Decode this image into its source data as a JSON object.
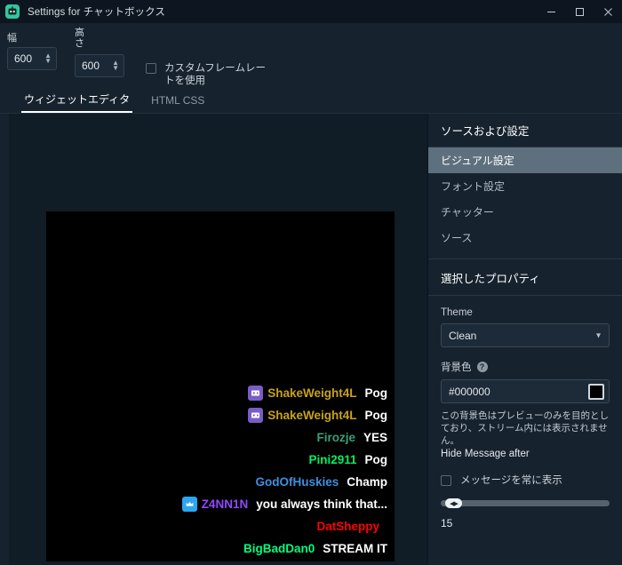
{
  "window": {
    "title": "Settings for チャットボックス",
    "app_icon": "chatbot-icon",
    "minimize_label": "−",
    "maximize_label": "□",
    "close_label": "✕"
  },
  "dimensions": {
    "width_label": "幅",
    "width_value": "600",
    "height_label": "高さ",
    "height_value": "600",
    "custom_framerate_label": "カスタムフレームレートを使用",
    "custom_framerate_checked": false
  },
  "tabs": [
    {
      "label": "ウィジェットエディタ",
      "active": true
    },
    {
      "label": "HTML CSS",
      "active": false
    }
  ],
  "preview": {
    "background": "#000000",
    "messages": [
      {
        "badge": "mod-badge",
        "badge_color": "#7a5cc6",
        "username": "ShakeWeight4L",
        "color": "#c8a21a",
        "message": "Pog"
      },
      {
        "badge": "mod-badge",
        "badge_color": "#7a5cc6",
        "username": "ShakeWeight4L",
        "color": "#c8a21a",
        "message": "Pog"
      },
      {
        "badge": null,
        "badge_color": "",
        "username": "Firozje",
        "color": "#3a9e7e",
        "message": "YES"
      },
      {
        "badge": null,
        "badge_color": "",
        "username": "Pini2911",
        "color": "#00f060",
        "message": "Pog"
      },
      {
        "badge": null,
        "badge_color": "",
        "username": "GodOfHuskies",
        "color": "#3e8fe0",
        "message": "Champ"
      },
      {
        "badge": "prime-badge",
        "badge_color": "#2ba7ef",
        "username": "Z4NN1N",
        "color": "#9146ff",
        "message": "you always think that..."
      },
      {
        "badge": null,
        "badge_color": "",
        "username": "DatSheppy",
        "color": "#ff0000",
        "message": ""
      },
      {
        "badge": null,
        "badge_color": "",
        "username": "BigBadDan0",
        "color": "#00ff7f",
        "message": "STREAM IT"
      }
    ]
  },
  "sidebar": {
    "section_title": "ソースおよび設定",
    "items": [
      {
        "label": "ビジュアル設定",
        "active": true
      },
      {
        "label": "フォント設定",
        "active": false
      },
      {
        "label": "チャッター",
        "active": false
      },
      {
        "label": "ソース",
        "active": false
      }
    ],
    "properties_header": "選択したプロパティ",
    "theme_label": "Theme",
    "theme_value": "Clean",
    "theme_caret": "chevron-down-icon",
    "bg_label": "背景色",
    "bg_help": "?",
    "bg_value": "#000000",
    "bg_swatch": "#000000",
    "helper_text": "この背景色はプレビューのみを目的としており、ストリーム内には表示されません。",
    "hide_after_label": "Hide Message after",
    "always_show_label": "メッセージを常に表示",
    "always_show_checked": false,
    "slider_value": "15",
    "slider_thumb_glyph": "◀▶"
  }
}
